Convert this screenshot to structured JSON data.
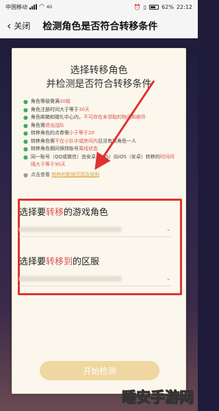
{
  "status_bar": {
    "carrier": "中国移动",
    "network": "4G",
    "icons": [
      "signal-icon",
      "wifi-icon",
      "alarm-icon",
      "vibrate-icon",
      "battery-icon"
    ],
    "battery": "62%",
    "time": "22:12"
  },
  "header": {
    "back_label": "关闭",
    "title": "检测角色是否符合转移条件"
  },
  "card": {
    "title_line1": "选择转移角色",
    "title_line2": "并检测是否符合转移条件",
    "requirements": [
      {
        "pre": "角色等级需满",
        "hl": "30级",
        "post": ""
      },
      {
        "pre": "角色注册时间大于等于",
        "hl": "30天",
        "post": ""
      },
      {
        "pre": "角色邮箱和赠礼中心内，",
        "hl": "不可存在未领取的物品和邮件",
        "post": ""
      },
      {
        "pre": "角色需",
        "hl": "退出战队",
        "post": ""
      },
      {
        "pre": "转移角色的点券需",
        "hl": "小于等于20",
        "post": ""
      },
      {
        "pre": "转移角色需",
        "hl": "不在小队中或房间内",
        "post": "且没有该角色一人"
      },
      {
        "pre": "转移角色期间保持账号",
        "hl": "离线状态",
        "post": ""
      },
      {
        "pre": "同一账号（QQ或微信）由安卓（iOS）向iOS（安卓）转移的",
        "hl": "时间间隔大于等于90天",
        "post": ""
      }
    ],
    "link_prefix": "点击查看",
    "link_text": "转移的数据范围及规则"
  },
  "selection": {
    "role_label_pre": "选择要",
    "role_label_hl": "转移",
    "role_label_post": "的游戏角色",
    "server_label_pre": "选择要",
    "server_label_hl": "转移到",
    "server_label_post": "的区服"
  },
  "start_button": "开始检测",
  "watermark": "睡安手游网",
  "colors": {
    "accent": "#d9534f",
    "highlight_box": "#e03131",
    "link": "#d9a23a",
    "check": "#3fae5a",
    "button": "#f0d6a0"
  }
}
